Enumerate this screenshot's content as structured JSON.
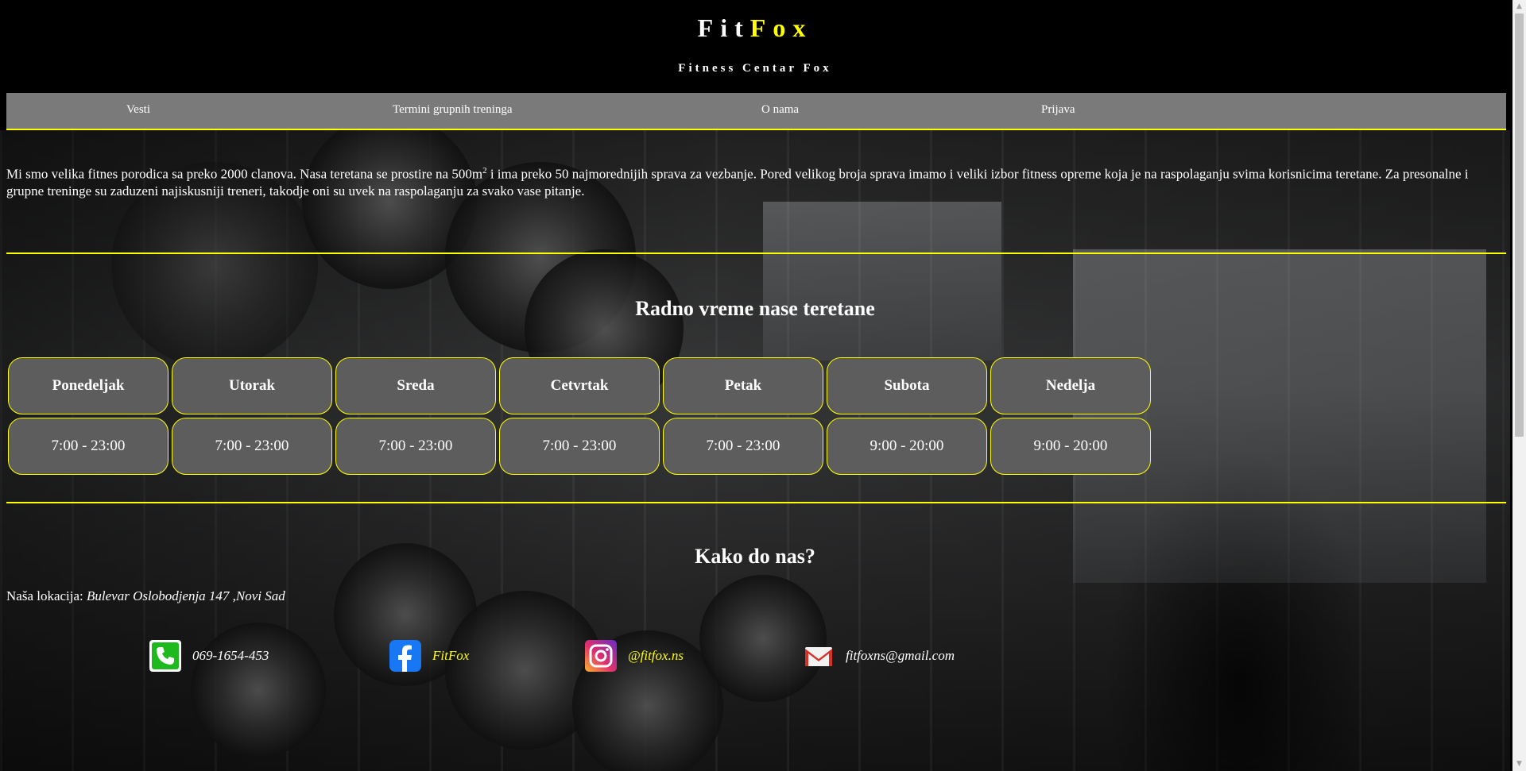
{
  "header": {
    "logo_part1": "Fit",
    "logo_part2": "Fox",
    "subtitle": "Fitness Centar Fox"
  },
  "nav": {
    "items": [
      {
        "label": "Vesti"
      },
      {
        "label": "Termini grupnih treninga"
      },
      {
        "label": "O nama"
      },
      {
        "label": "Prijava"
      }
    ]
  },
  "about": {
    "text_before": "Mi smo velika fitnes porodica sa preko 2000 clanova. Nasa teretana se prostire na 500m",
    "sup": "2",
    "text_after": " i ima preko 50 najmorednijih sprava za vezbanje. Pored velikog broja sprava imamo i veliki izbor fitness opreme koja je na raspolaganju svima korisnicima teretane. Za presonalne i grupne treninge su zaduzeni najiskusniji treneri, takodje oni su uvek na raspolaganju za svako vase pitanje."
  },
  "hours": {
    "title": "Radno vreme nase teretane",
    "days": [
      {
        "day": "Ponedeljak",
        "time": "7:00 - 23:00"
      },
      {
        "day": "Utorak",
        "time": "7:00 - 23:00"
      },
      {
        "day": "Sreda",
        "time": "7:00 - 23:00"
      },
      {
        "day": "Cetvrtak",
        "time": "7:00 - 23:00"
      },
      {
        "day": "Petak",
        "time": "7:00 - 23:00"
      },
      {
        "day": "Subota",
        "time": "9:00 - 20:00"
      },
      {
        "day": "Nedelja",
        "time": "9:00 - 20:00"
      }
    ]
  },
  "location": {
    "title": "Kako do nas?",
    "label": "Naša lokacija: ",
    "address": "Bulevar Oslobodjenja 147 ,Novi Sad"
  },
  "contacts": {
    "phone": {
      "icon": "phone-icon",
      "text": "069-1654-453"
    },
    "facebook": {
      "icon": "facebook-icon",
      "text": "FitFox"
    },
    "instagram": {
      "icon": "instagram-icon",
      "text": "@fitfox.ns"
    },
    "email": {
      "icon": "gmail-icon",
      "text": "fitfoxns@gmail.com"
    }
  },
  "colors": {
    "accent": "#ffff00",
    "nav_bg": "#7a7a7a",
    "cell_bg": "#5d5d5d"
  }
}
